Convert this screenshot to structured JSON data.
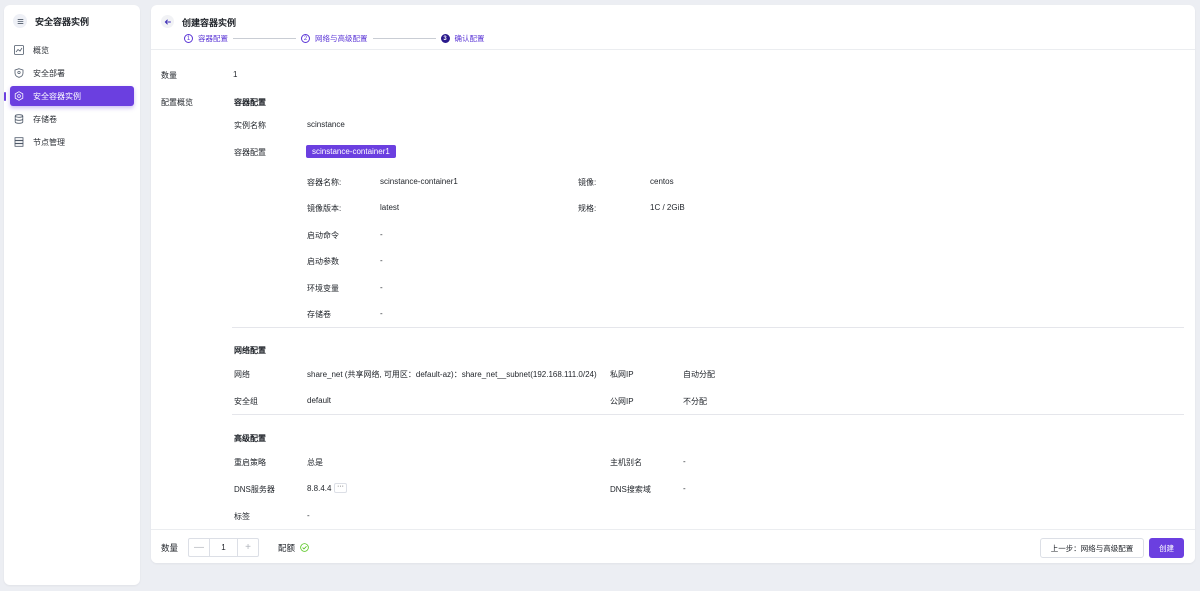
{
  "sidebar": {
    "title": "安全容器实例",
    "items": [
      {
        "label": "概览",
        "icon": "chart-icon"
      },
      {
        "label": "安全部署",
        "icon": "shield-icon"
      },
      {
        "label": "安全容器实例",
        "icon": "container-icon",
        "active": true
      },
      {
        "label": "存储卷",
        "icon": "database-icon"
      },
      {
        "label": "节点管理",
        "icon": "server-icon"
      }
    ]
  },
  "header": {
    "title": "创建容器实例",
    "steps": [
      {
        "num": "1",
        "label": "容器配置"
      },
      {
        "num": "2",
        "label": "网络与高级配置"
      },
      {
        "num": "3",
        "label": "确认配置",
        "current": true
      }
    ]
  },
  "summary": {
    "quantity_label": "数量",
    "quantity_value": "1",
    "overview_label": "配置概览"
  },
  "container_config": {
    "section_title": "容器配置",
    "instance_name_label": "实例名称",
    "instance_name": "scinstance",
    "container_label": "容器配置",
    "container_tag": "scinstance-container1",
    "fields": {
      "name_label": "容器名称:",
      "name": "scinstance-container1",
      "image_label": "镜像:",
      "image": "centos",
      "version_label": "镜像版本:",
      "version": "latest",
      "spec_label": "规格:",
      "spec": "1C / 2GiB",
      "cmd_label": "启动命令",
      "cmd": "-",
      "args_label": "启动参数",
      "args": "-",
      "env_label": "环境变量",
      "env": "-",
      "volume_label": "存储卷",
      "volume": "-"
    }
  },
  "network_config": {
    "section_title": "网络配置",
    "network_label": "网络",
    "network": "share_net (共享网络, 可用区：default-az)：share_net__subnet(192.168.111.0/24)",
    "private_ip_label": "私网IP",
    "private_ip": "自动分配",
    "sg_label": "安全组",
    "sg": "default",
    "public_ip_label": "公网IP",
    "public_ip": "不分配"
  },
  "advanced_config": {
    "section_title": "高级配置",
    "restart_label": "重启策略",
    "restart": "总是",
    "hostname_label": "主机别名",
    "hostname": "-",
    "dns_label": "DNS服务器",
    "dns": "8.8.4.4",
    "dns_more": "···",
    "dns_search_label": "DNS搜索域",
    "dns_search": "-",
    "tags_label": "标签",
    "tags": "-"
  },
  "footer": {
    "quantity_label": "数量",
    "quantity": "1",
    "minus": "—",
    "plus": "+",
    "quota_label": "配额",
    "prev_button": "上一步：网络与高级配置",
    "create_button": "创建"
  },
  "colors": {
    "accent": "#6b3fe0",
    "success": "#52c41a"
  }
}
